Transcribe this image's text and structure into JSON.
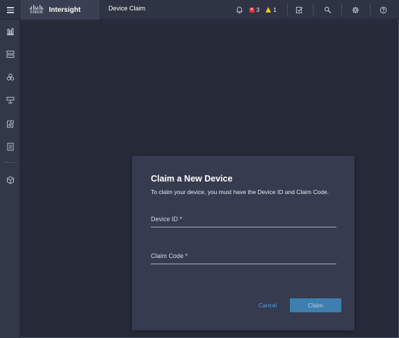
{
  "header": {
    "brand_name": "Intersight",
    "cisco_word": "CISCO",
    "page_title": "Device Claim",
    "alerts": {
      "critical_count": "3",
      "warning_count": "1"
    },
    "icons": [
      "bell-icon",
      "error-icon",
      "warning-icon",
      "tasks-icon",
      "search-icon",
      "gear-icon",
      "help-icon"
    ]
  },
  "sidebar": {
    "items": [
      {
        "icon": "dashboard-icon"
      },
      {
        "icon": "servers-icon"
      },
      {
        "icon": "hyperflex-icon"
      },
      {
        "icon": "fabric-interconnect-icon"
      },
      {
        "icon": "policies-icon"
      },
      {
        "icon": "profiles-icon"
      },
      {
        "icon": "software-repository-icon"
      }
    ]
  },
  "dialog": {
    "title": "Claim a New Device",
    "subtitle": "To claim your device, you must have the Device ID and Claim Code.",
    "device_id_placeholder": "Device ID *",
    "device_id_value": "",
    "claim_code_placeholder": "Claim Code *",
    "claim_code_value": "",
    "cancel_label": "Cancel",
    "claim_label": "Claim"
  },
  "colors": {
    "accent_blue": "#4aa3e8",
    "primary_button": "#3f7fb0",
    "critical": "#e0353a",
    "warning": "#f6c21a",
    "background": "#272b39",
    "dialog_bg": "#363b4f"
  }
}
